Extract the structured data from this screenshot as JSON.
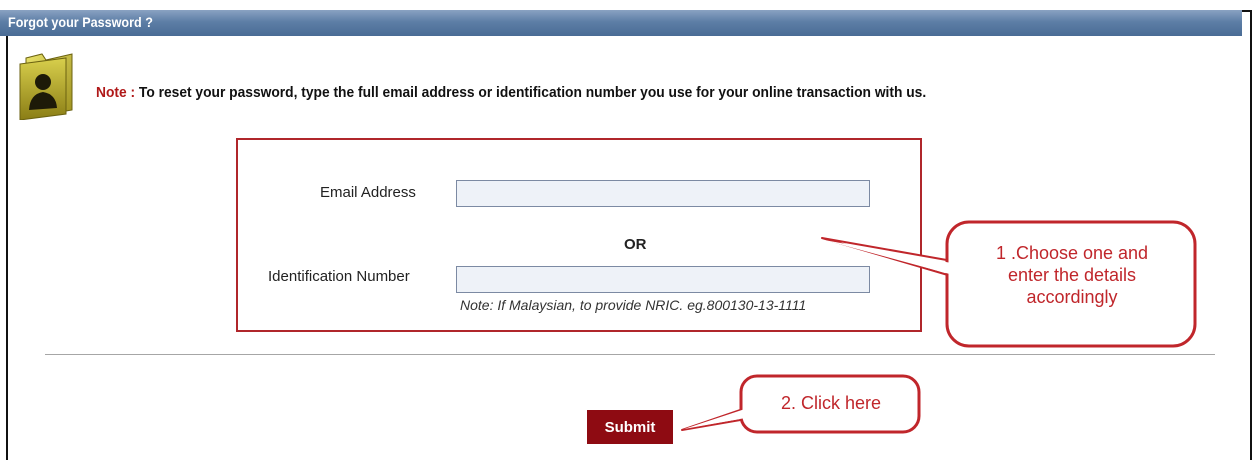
{
  "header": {
    "title": "Forgot your Password ?"
  },
  "note": {
    "label": "Note :",
    "text": " To reset your password, type the full email address or identification number you use for your online transaction with us."
  },
  "form": {
    "email_label": "Email Address",
    "email_value": "",
    "or_text": "OR",
    "id_label": "Identification Number",
    "id_value": "",
    "id_hint": "Note: If Malaysian, to provide NRIC. eg.800130-13-1111"
  },
  "submit_label": "Submit",
  "callouts": {
    "one_line1": "1 .Choose one and",
    "one_line2": "enter the details",
    "one_line3": "accordingly",
    "two": "2. Click here"
  },
  "colors": {
    "header_blue": "#4a6c95",
    "accent_red": "#b0262b",
    "submit_bg": "#8e0b12"
  },
  "icons": {
    "folder": "user-folder-icon"
  }
}
